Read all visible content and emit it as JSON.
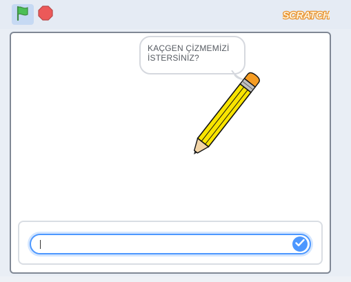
{
  "toolbar": {
    "green_flag": {
      "icon": "green-flag-icon",
      "color": "#4cbf56"
    },
    "stop": {
      "icon": "stop-icon",
      "color": "#ec5959"
    },
    "logo_text": "SCRATCH",
    "logo_color": "#f7a63d"
  },
  "stage": {
    "speech_bubble": {
      "line1": "KAÇGEN ÇİZMEMİZİ",
      "line2": "İSTERSİNİZ?"
    },
    "sprite": {
      "icon": "pencil-icon"
    }
  },
  "ask_prompt": {
    "value": "",
    "submit_icon": "check-icon",
    "accent": "#4c97ff"
  }
}
